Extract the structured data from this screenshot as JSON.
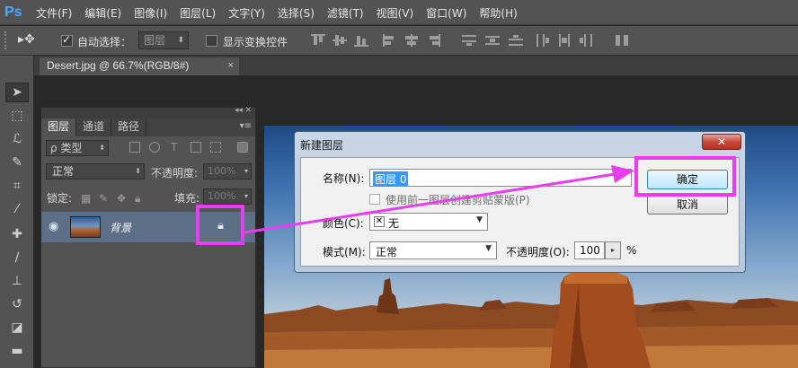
{
  "app": {
    "logo": "Ps"
  },
  "menu": [
    "文件(F)",
    "编辑(E)",
    "图像(I)",
    "图层(L)",
    "文字(Y)",
    "选择(S)",
    "滤镜(T)",
    "视图(V)",
    "窗口(W)",
    "帮助(H)"
  ],
  "options": {
    "move_icon": "▸✥",
    "auto_select_label": "自动选择：",
    "auto_select_target": "图层",
    "show_transform_label": "显示变换控件"
  },
  "document": {
    "tab_title": "Desert.jpg @ 66.7%(RGB/8#)",
    "close": "×"
  },
  "layers_panel": {
    "tabs": [
      "图层",
      "通道",
      "路径"
    ],
    "filter_kind": "ρ 类型",
    "blend_mode": "正常",
    "opacity_label": "不透明度:",
    "opacity_value": "100%",
    "lock_label": "锁定:",
    "fill_label": "填充:",
    "fill_value": "100%",
    "layer": {
      "name": "背景",
      "visibility_icon": "eye-icon",
      "lock_icon": "lock-icon"
    }
  },
  "dialog": {
    "title": "新建图层",
    "close": "✕",
    "name_label": "名称(N):",
    "name_value": "图层 0",
    "clip_label": "使用前一图层创建剪贴蒙版(P)",
    "color_label": "颜色(C):",
    "color_value": "无",
    "mode_label": "模式(M):",
    "mode_value": "正常",
    "opacity_label": "不透明度(O):",
    "opacity_value": "100",
    "percent": "%",
    "ok_button": "确定",
    "cancel_button": "取消"
  },
  "colors": {
    "highlight": "#e93df0",
    "ui_dark": "#535353",
    "layer_selected": "#5c6f86"
  }
}
